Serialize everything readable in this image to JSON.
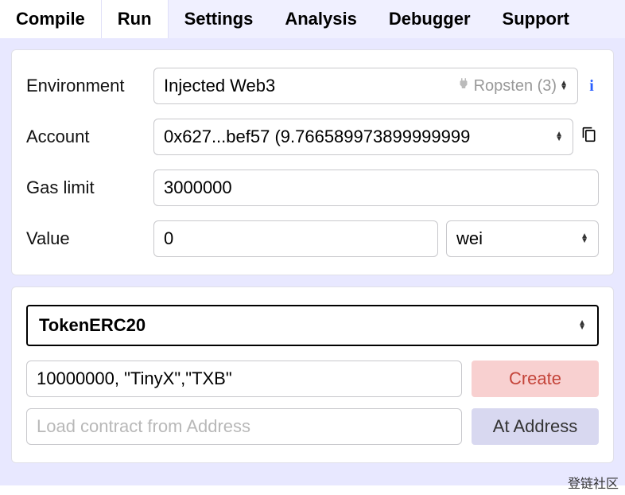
{
  "tabs": {
    "t0": "Compile",
    "t1": "Run",
    "t2": "Settings",
    "t3": "Analysis",
    "t4": "Debugger",
    "t5": "Support"
  },
  "panel1": {
    "environment_label": "Environment",
    "environment_value": "Injected Web3",
    "network_name": "Ropsten (3)",
    "account_label": "Account",
    "account_value": "0x627...bef57 (9.766589973899999999",
    "gas_label": "Gas limit",
    "gas_value": "3000000",
    "value_label": "Value",
    "value_value": "0",
    "unit_value": "wei"
  },
  "panel2": {
    "contract_name": "TokenERC20",
    "params_value": "10000000, \"TinyX\",\"TXB\"",
    "create_label": "Create",
    "load_placeholder": "Load contract from Address",
    "ataddress_label": "At Address"
  },
  "watermark": "登链社区"
}
